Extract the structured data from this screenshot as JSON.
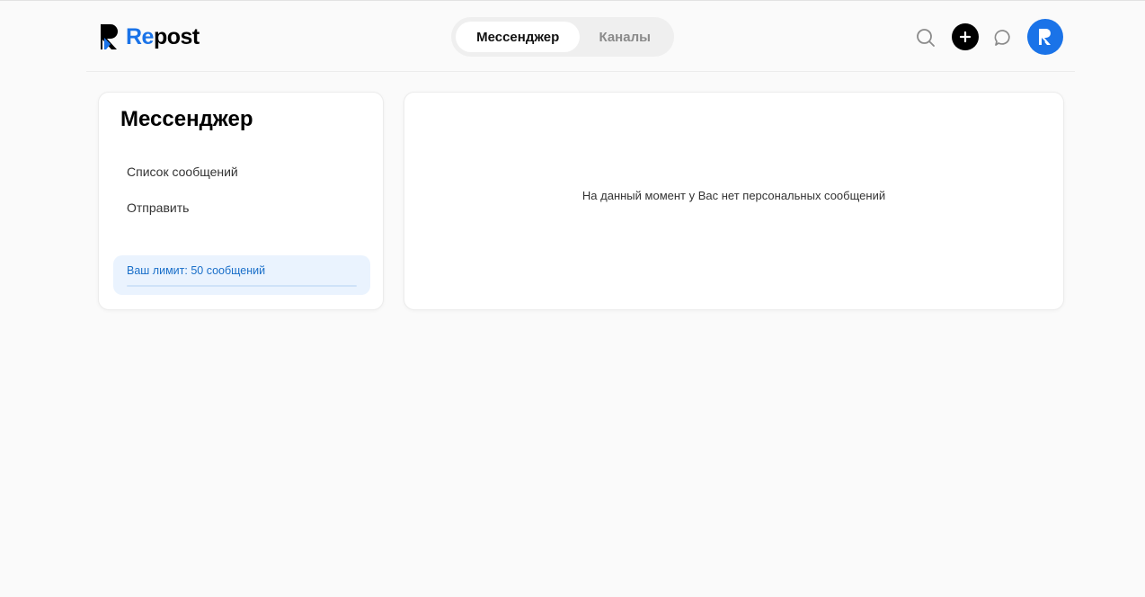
{
  "brand": {
    "name_part1": "Re",
    "name_part2": "post",
    "accent_color": "#1a73e8"
  },
  "header": {
    "tabs": [
      {
        "label": "Мессенджер",
        "active": true
      },
      {
        "label": "Каналы",
        "active": false
      }
    ],
    "icons": [
      "search-icon",
      "plus-icon",
      "chat-icon",
      "avatar-logo-icon"
    ]
  },
  "sidebar": {
    "title": "Мессенджер",
    "items": [
      {
        "label": "Список сообщений"
      },
      {
        "label": "Отправить"
      }
    ],
    "limit": {
      "label": "Ваш лимит: 50 сообщений",
      "progress_percent": 0
    }
  },
  "main": {
    "empty_message": "На данный момент у Вас нет персональных сообщений"
  }
}
